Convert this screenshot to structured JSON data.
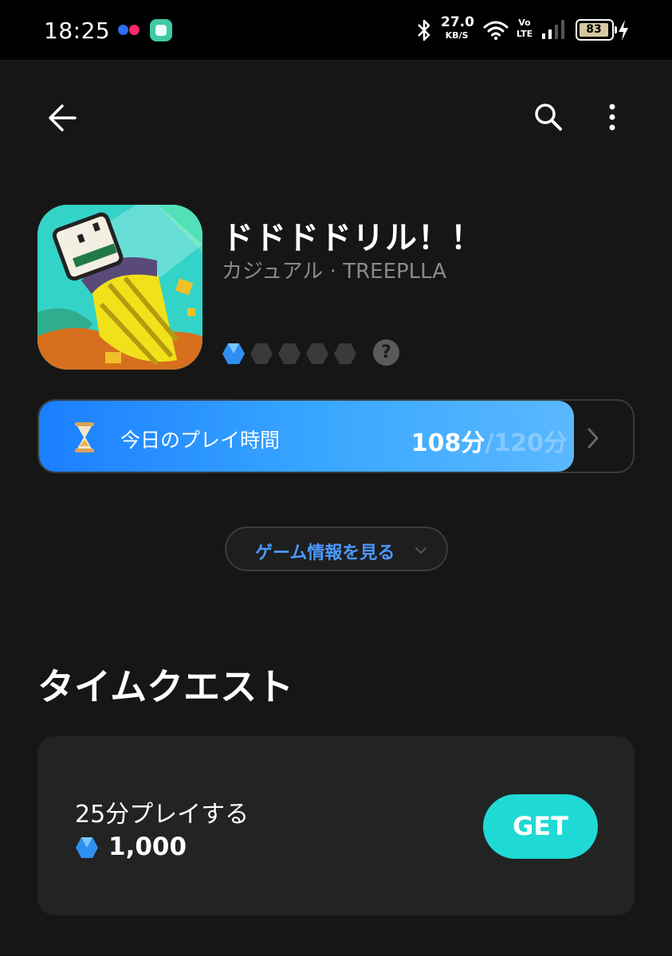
{
  "status_bar": {
    "time": "18:25",
    "net_speed_value": "27.0",
    "net_speed_unit": "KB/S",
    "volte_top": "Vo",
    "volte_bottom": "LTE",
    "battery": "83"
  },
  "app": {
    "title": "ドドドドリル！！",
    "subtitle": "カジュアル · TREEPLLA",
    "rating": {
      "filled": 1,
      "total": 5
    },
    "help_icon": "?"
  },
  "playtime": {
    "label": "今日のプレイ時間",
    "current": "108分",
    "total": "/120分",
    "progress": 0.9
  },
  "game_info_button": "ゲーム情報を見る",
  "section_title": "タイムクエスト",
  "quest": {
    "name": "25分プレイする",
    "reward": "1,000",
    "get_label": "GET"
  },
  "colors": {
    "accent_blue": "#1a7fff",
    "get_button": "#1fd9d5",
    "background": "#161616",
    "card": "#222323"
  }
}
